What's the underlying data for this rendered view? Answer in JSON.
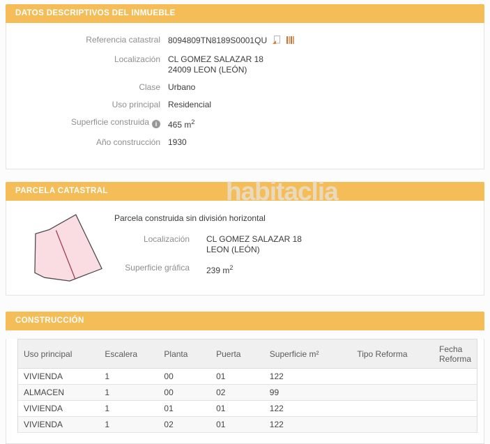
{
  "theme": {
    "accent_color": "#f4bd58",
    "label_color": "#8f8f8f",
    "value_color": "#3b3b3b"
  },
  "watermark_text": "habitaclia",
  "inmueble": {
    "title": "DATOS DESCRIPTIVOS DEL INMUEBLE",
    "referencia": {
      "label": "Referencia catastral",
      "value": "8094809TN8189S0001QU"
    },
    "localizacion": {
      "label": "Localización",
      "line1": "CL GOMEZ SALAZAR 18",
      "line2": "24009 LEON (LEÓN)"
    },
    "clase": {
      "label": "Clase",
      "value": "Urbano"
    },
    "uso_principal": {
      "label": "Uso principal",
      "value": "Residencial"
    },
    "superficie": {
      "label": "Superficie construida",
      "info_icon_glyph": "i",
      "value": "465 m",
      "sup": "2"
    },
    "ano_construccion": {
      "label": "Año construcción",
      "value": "1930"
    }
  },
  "parcela": {
    "title": "PARCELA CATASTRAL",
    "note": "Parcela construida sin división horizontal",
    "localizacion": {
      "label": "Localización",
      "line1": "CL GOMEZ SALAZAR 18",
      "line2": "LEON (LEÓN)"
    },
    "superficie_grafica": {
      "label": "Superficie gráfica",
      "value": "239 m",
      "sup": "2"
    },
    "parcel_shape": {
      "fill": "#f9dde3",
      "outline": "#4f4a49",
      "divider": "#a13b4e"
    }
  },
  "construccion": {
    "title": "CONSTRUCCIÓN",
    "table": {
      "headers": [
        "Uso principal",
        "Escalera",
        "Planta",
        "Puerta",
        "Superficie m²",
        "Tipo Reforma",
        "Fecha Reforma"
      ],
      "rows": [
        [
          "VIVIENDA",
          "1",
          "00",
          "01",
          "122",
          "",
          ""
        ],
        [
          "ALMACEN",
          "1",
          "00",
          "02",
          "99",
          "",
          ""
        ],
        [
          "VIVIENDA",
          "1",
          "01",
          "01",
          "122",
          "",
          ""
        ],
        [
          "VIVIENDA",
          "1",
          "02",
          "01",
          "122",
          "",
          ""
        ]
      ]
    }
  }
}
